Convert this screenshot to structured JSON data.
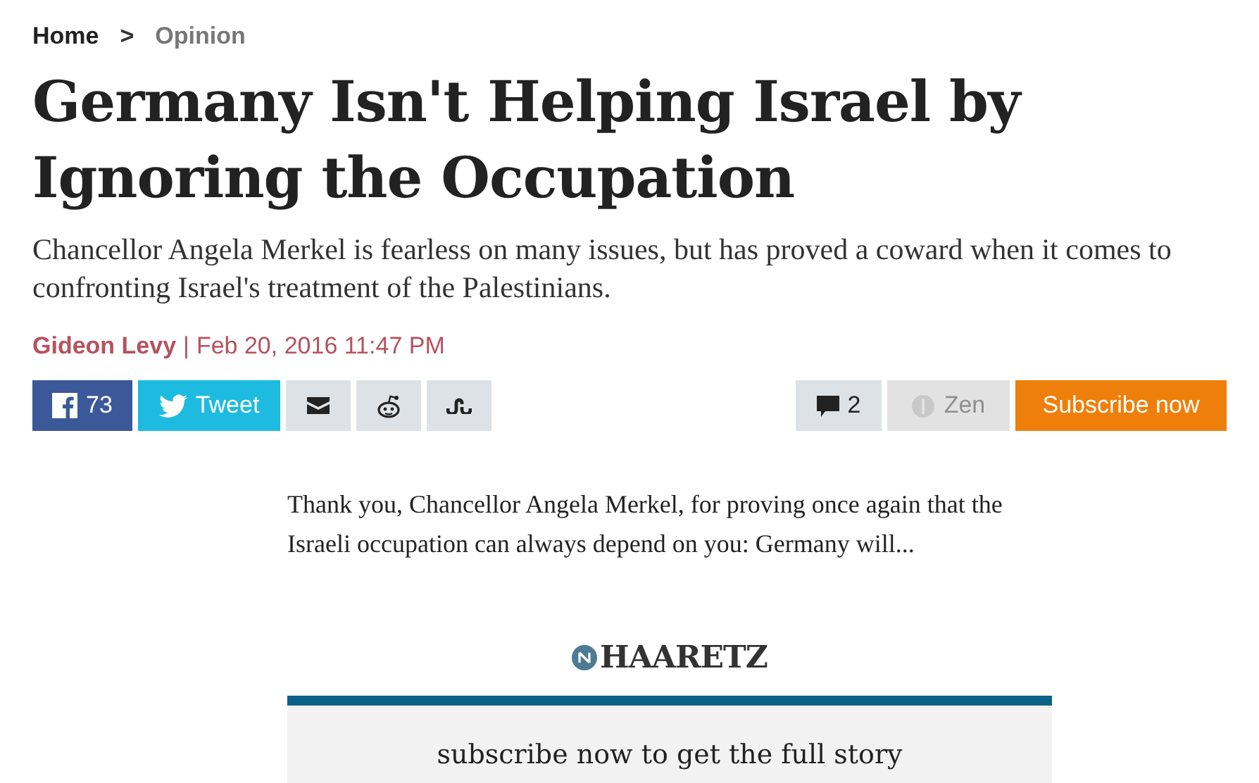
{
  "breadcrumb": [
    {
      "label": "Home",
      "selected": false
    },
    {
      "label": "Opinion",
      "selected": true
    }
  ],
  "breadcrumb_separator": ">",
  "headline": "Germany Isn't Helping Israel by Ignoring the Occupation",
  "subheadline": "Chancellor Angela Merkel is fearless on many issues, but has proved a coward when it comes to confronting Israel's treatment of the Palestinians.",
  "byline": {
    "author": "Gideon Levy",
    "separator": "|",
    "date": "Feb 20, 2016 11:47 PM"
  },
  "share_buttons": [
    {
      "kind": "facebook",
      "label": "73"
    },
    {
      "kind": "twitter",
      "label": "Tweet"
    },
    {
      "kind": "email"
    },
    {
      "kind": "reddit"
    },
    {
      "kind": "stumbleupon"
    }
  ],
  "actions": [
    {
      "kind": "comments",
      "label": "2",
      "disabled": false
    },
    {
      "kind": "zen",
      "label": "Zen",
      "disabled": true
    },
    {
      "kind": "subscribe",
      "label": "Subscribe now",
      "disabled": false
    }
  ],
  "teaser": "Thank you, Chancellor Angela Merkel, for proving once again that the Israeli occupation can always depend on you: Germany will...",
  "paywall": {
    "logo": "HAARETZ",
    "message": "subscribe now to get the full story"
  }
}
